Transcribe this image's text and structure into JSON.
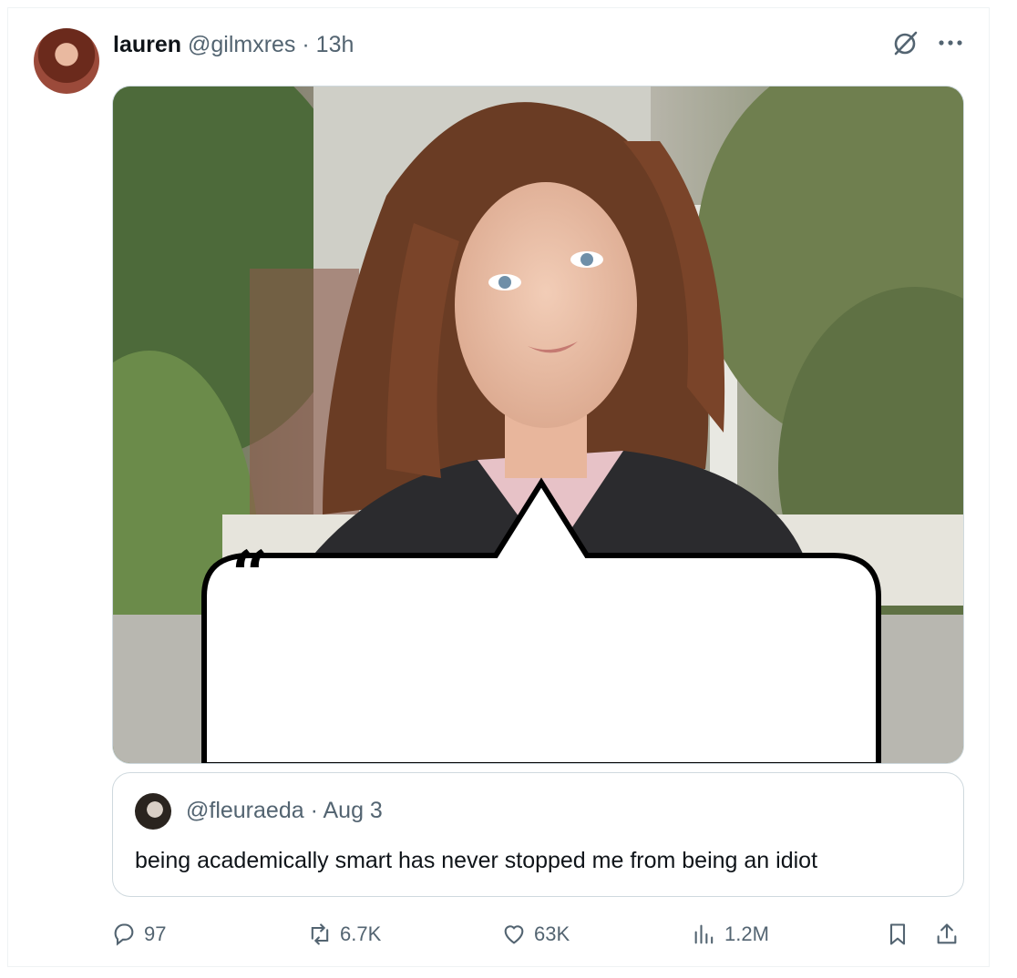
{
  "tweet": {
    "display_name": "lauren",
    "handle": "@gilmxres",
    "separator": "·",
    "time": "13h",
    "icons": {
      "grok": "grok-icon",
      "more": "more-icon"
    }
  },
  "quote": {
    "handle": "@fleuraeda",
    "separator": "·",
    "date": "Aug 3",
    "text": "being academically smart has never stopped me from being an idiot"
  },
  "actions": {
    "replies": "97",
    "reposts": "6.7K",
    "likes": "63K",
    "views": "1.2M",
    "icons": [
      "reply-icon",
      "repost-icon",
      "like-icon",
      "views-icon",
      "bookmark-icon",
      "share-icon"
    ]
  },
  "colors": {
    "text": "#0f1419",
    "secondary": "#536471",
    "border": "#cfd9de"
  }
}
